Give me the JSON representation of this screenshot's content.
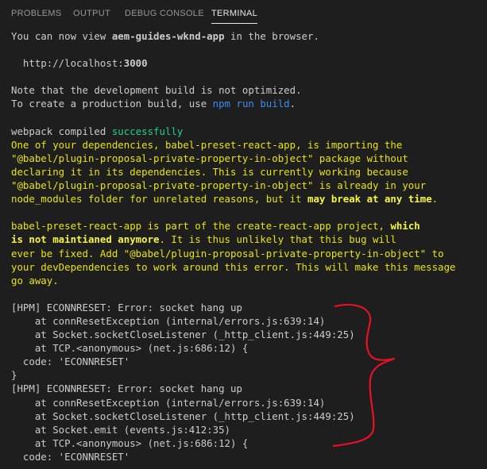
{
  "panel_tabs": [
    {
      "label": "PROBLEMS",
      "active": false
    },
    {
      "label": "OUTPUT",
      "active": false
    },
    {
      "label": "DEBUG CONSOLE",
      "active": false
    },
    {
      "label": "TERMINAL",
      "active": true
    }
  ],
  "terminal": {
    "lines": [
      [
        {
          "t": "You can now view ",
          "s": "def"
        },
        {
          "t": "aem-guides-wknd-app",
          "s": "bold"
        },
        {
          "t": " in the browser.",
          "s": "def"
        }
      ],
      [],
      [
        {
          "t": "  http://localhost:",
          "s": "def"
        },
        {
          "t": "3000",
          "s": "bold"
        }
      ],
      [],
      [
        {
          "t": "Note that the development build is not optimized.",
          "s": "def"
        }
      ],
      [
        {
          "t": "To create a production build, use ",
          "s": "def"
        },
        {
          "t": "npm run build",
          "s": "cyan"
        },
        {
          "t": ".",
          "s": "def"
        }
      ],
      [],
      [
        {
          "t": "webpack compiled ",
          "s": "def"
        },
        {
          "t": "successfully",
          "s": "green"
        }
      ],
      [
        {
          "t": "One of your dependencies, babel-preset-react-app, is importing the",
          "s": "yellow"
        }
      ],
      [
        {
          "t": "\"@babel/plugin-proposal-private-property-in-object\" package without",
          "s": "yellow"
        }
      ],
      [
        {
          "t": "declaring it in its dependencies. This is currently working because",
          "s": "yellow"
        }
      ],
      [
        {
          "t": "\"@babel/plugin-proposal-private-property-in-object\" is already in your",
          "s": "yellow"
        }
      ],
      [
        {
          "t": "node_modules folder for unrelated reasons, but it ",
          "s": "yellow"
        },
        {
          "t": "may break at any time",
          "s": "ybold"
        },
        {
          "t": ".",
          "s": "yellow"
        }
      ],
      [],
      [
        {
          "t": "babel-preset-react-app is part of the create-react-app project, ",
          "s": "yellow"
        },
        {
          "t": "which",
          "s": "ybold"
        }
      ],
      [
        {
          "t": "is not maintianed anymore",
          "s": "ybold"
        },
        {
          "t": ". It is thus unlikely that this bug will",
          "s": "yellow"
        }
      ],
      [
        {
          "t": "ever be fixed. Add \"@babel/plugin-proposal-private-property-in-object\" to",
          "s": "yellow"
        }
      ],
      [
        {
          "t": "your devDependencies to work around this error. This will make this message",
          "s": "yellow"
        }
      ],
      [
        {
          "t": "go away.",
          "s": "yellow"
        }
      ],
      [],
      [
        {
          "t": "[HPM] ECONNRESET: Error: socket hang up",
          "s": "def"
        }
      ],
      [
        {
          "t": "    at connResetException (internal/errors.js:639:14)",
          "s": "def"
        }
      ],
      [
        {
          "t": "    at Socket.socketCloseListener (_http_client.js:449:25)",
          "s": "def"
        }
      ],
      [
        {
          "t": "    at TCP.<anonymous> (net.js:686:12) {",
          "s": "def"
        }
      ],
      [
        {
          "t": "  code: 'ECONNRESET'",
          "s": "def"
        }
      ],
      [
        {
          "t": "}",
          "s": "def"
        }
      ],
      [
        {
          "t": "[HPM] ECONNRESET: Error: socket hang up",
          "s": "def"
        }
      ],
      [
        {
          "t": "    at connResetException (internal/errors.js:639:14)",
          "s": "def"
        }
      ],
      [
        {
          "t": "    at Socket.socketCloseListener (_http_client.js:449:25)",
          "s": "def"
        }
      ],
      [
        {
          "t": "    at Socket.emit (events.js:412:35)",
          "s": "def"
        }
      ],
      [
        {
          "t": "    at TCP.<anonymous> (net.js:686:12) {",
          "s": "def"
        }
      ],
      [
        {
          "t": "  code: 'ECONNRESET'",
          "s": "def"
        }
      ]
    ]
  },
  "colors": {
    "background": "#1e1e1e",
    "default_text": "#cccccc",
    "warning_yellow": "#e5e510",
    "success_green": "#23d18b",
    "command_blue": "#3b8eea",
    "annotation_red": "#e81123"
  },
  "annotation": {
    "shape": "curly-brace",
    "color": "#e81123"
  }
}
